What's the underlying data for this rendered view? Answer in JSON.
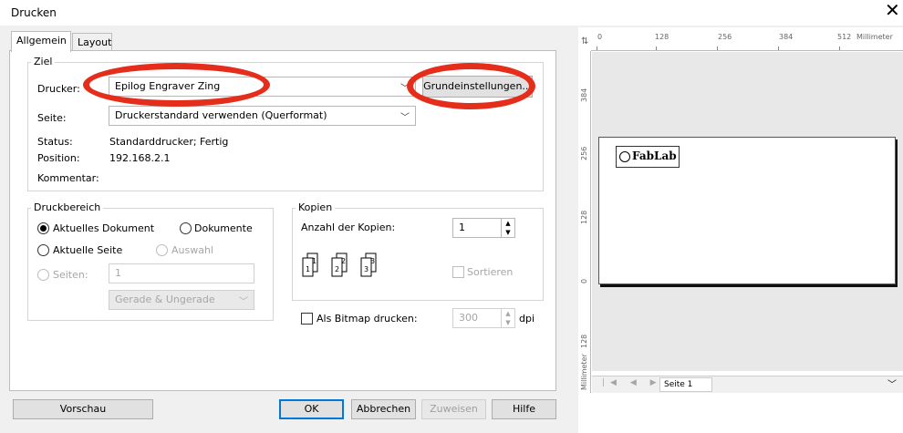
{
  "window": {
    "title": "Drucken",
    "close_glyph": "✕"
  },
  "tabs": [
    "Allgemein",
    "Layout"
  ],
  "ziel": {
    "legend": "Ziel",
    "printer_label": "Drucker:",
    "printer_value": "Epilog Engraver Zing",
    "settings_button": "Grundeinstellungen...",
    "page_label": "Seite:",
    "page_value": "Druckerstandard verwenden (Querformat)",
    "status_label": "Status:",
    "status_value": "Standarddrucker; Fertig",
    "position_label": "Position:",
    "position_value": "192.168.2.1",
    "comment_label": "Kommentar:"
  },
  "druckbereich": {
    "legend": "Druckbereich",
    "opt_current_doc": "Aktuelles Dokument",
    "opt_documents": "Dokumente",
    "opt_current_page": "Aktuelle Seite",
    "opt_selection": "Auswahl",
    "opt_pages": "Seiten:",
    "pages_value": "1",
    "parity_value": "Gerade & Ungerade"
  },
  "kopien": {
    "legend": "Kopien",
    "count_label": "Anzahl der Kopien:",
    "count_value": "1",
    "collate_label": "Sortieren"
  },
  "bitmap": {
    "label": "Als Bitmap drucken:",
    "value": "300",
    "unit": "dpi"
  },
  "buttons": {
    "preview": "Vorschau",
    "ok": "OK",
    "cancel": "Abbrechen",
    "apply": "Zuweisen",
    "help": "Hilfe"
  },
  "preview": {
    "ruler_h": [
      "0",
      "128",
      "256",
      "384",
      "512",
      "Millimeter"
    ],
    "ruler_v": [
      "384",
      "256",
      "128",
      "0",
      "128",
      "Millimeter"
    ],
    "logo_text": "FabLab",
    "page_tab": "Seite 1"
  },
  "colors": {
    "highlight": "#e52d1c",
    "focus": "#0078d7"
  }
}
